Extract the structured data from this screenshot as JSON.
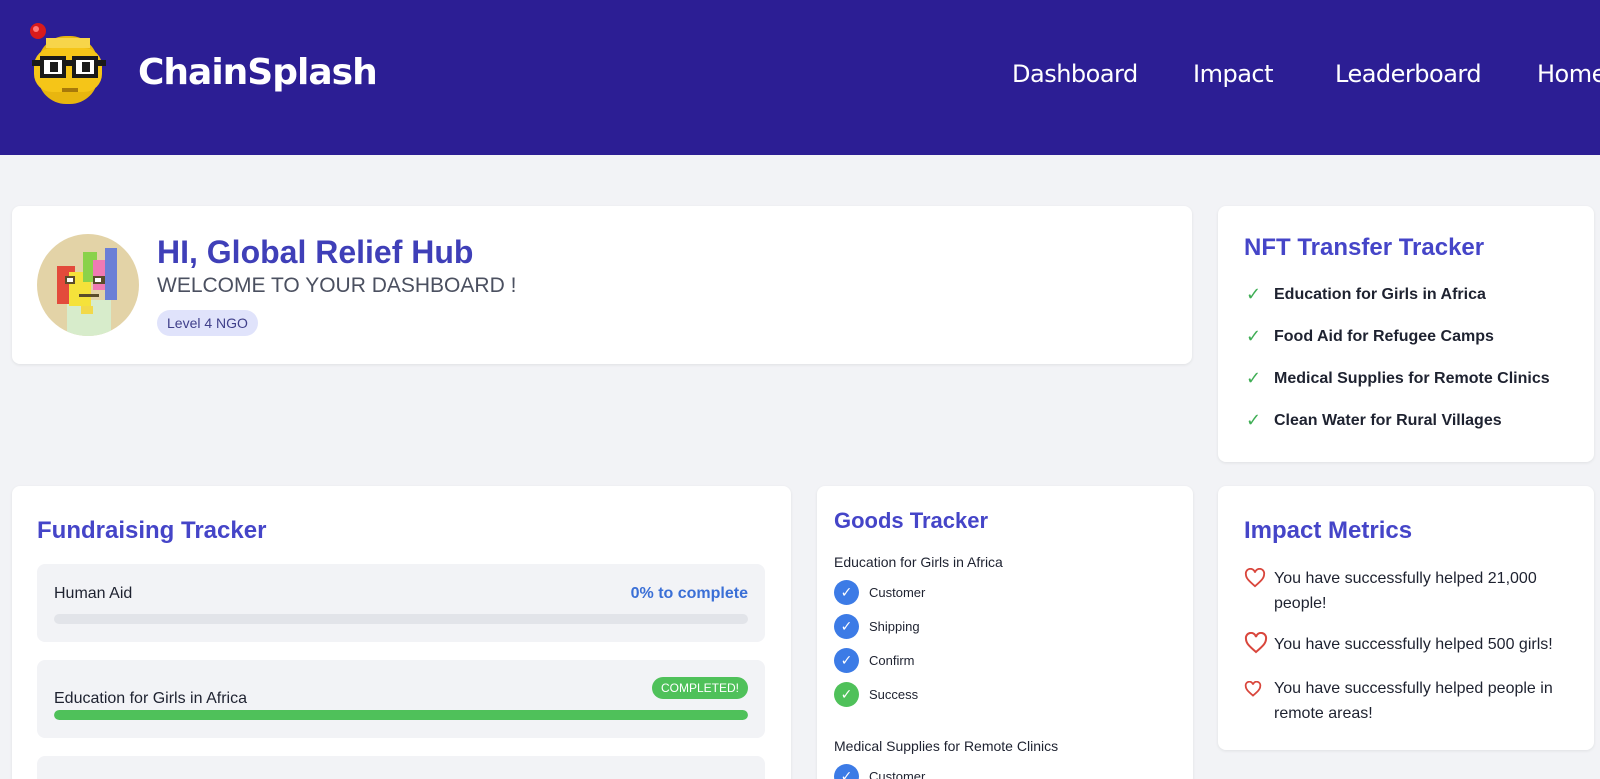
{
  "header": {
    "brand": "ChainSplash",
    "nav": [
      "Dashboard",
      "Impact",
      "Leaderboard",
      "Home"
    ]
  },
  "welcome": {
    "greeting": "HI, Global Relief Hub",
    "subtitle": "WELCOME TO YOUR DASHBOARD !",
    "level": "Level 4 NGO"
  },
  "nft_tracker": {
    "title": "NFT Transfer Tracker",
    "items": [
      "Education for Girls in Africa",
      "Food Aid for Refugee Camps",
      "Medical Supplies for Remote Clinics",
      "Clean Water for Rural Villages"
    ]
  },
  "fundraising": {
    "title": "Fundraising Tracker",
    "items": [
      {
        "label": "Human Aid",
        "status": "0% to complete",
        "progress": 0
      },
      {
        "label": "Education for Girls in Africa",
        "status": "COMPLETED!",
        "progress": 1
      }
    ]
  },
  "goods": {
    "title": "Goods Tracker",
    "groups": [
      {
        "name": "Education for Girls in Africa",
        "steps": [
          "Customer",
          "Shipping",
          "Confirm",
          "Success"
        ]
      },
      {
        "name": "Medical Supplies for Remote Clinics",
        "steps": [
          "Customer"
        ]
      }
    ]
  },
  "impact": {
    "title": "Impact Metrics",
    "items": [
      "You have successfully helped 21,000 people!",
      "You have successfully helped 500 girls!",
      "You have successfully helped people in remote areas!"
    ]
  },
  "colors": {
    "header_bg": "#2c1e94",
    "accent": "#4545c8",
    "success": "#4fc15a",
    "step_blue": "#3c7be6",
    "heart": "#d9463c"
  }
}
